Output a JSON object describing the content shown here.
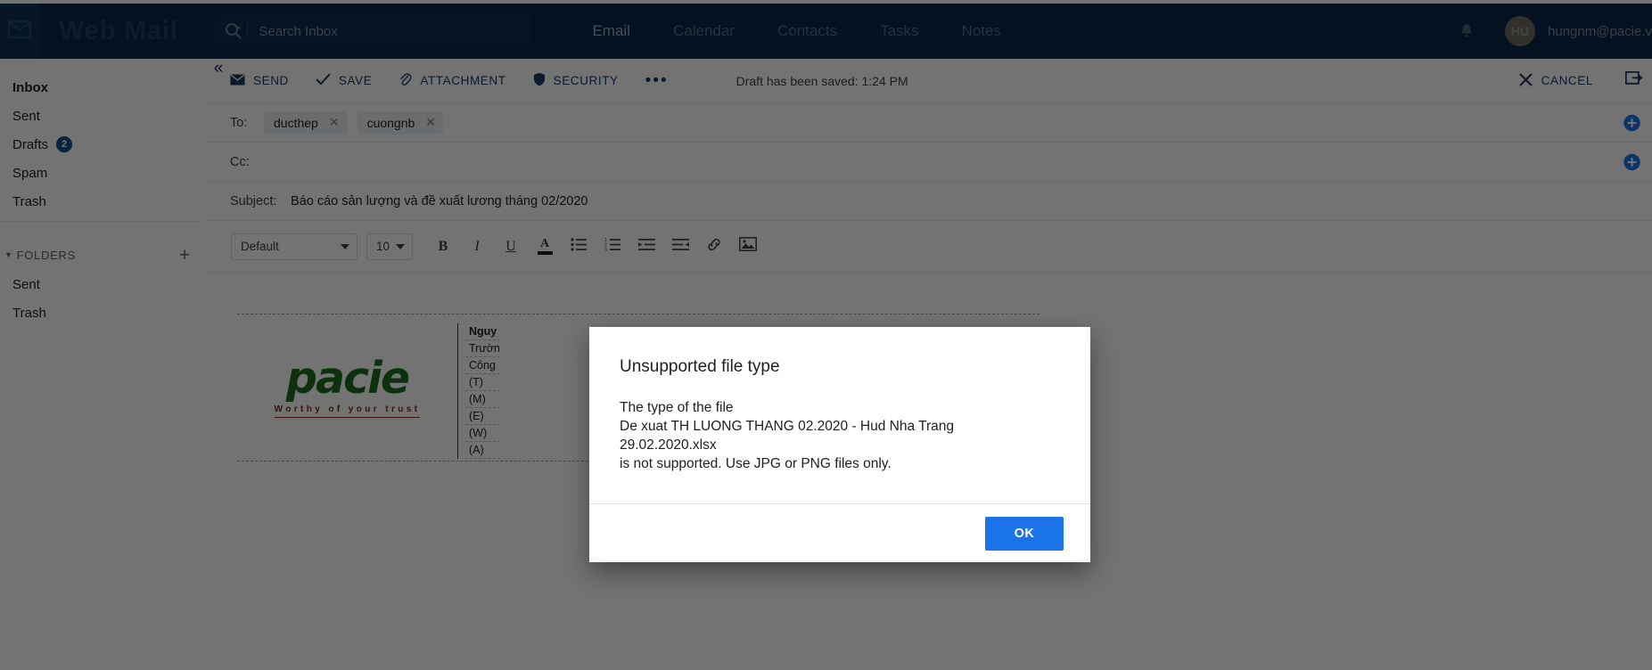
{
  "topnav": {
    "brand": "Web Mail",
    "mail_icon": "envelope-icon",
    "search": {
      "placeholder": "Search Inbox",
      "value": "",
      "icon": "search-icon"
    },
    "tabs": [
      {
        "label": "Email",
        "active": true
      },
      {
        "label": "Calendar",
        "active": false
      },
      {
        "label": "Contacts",
        "active": false
      },
      {
        "label": "Tasks",
        "active": false
      },
      {
        "label": "Notes",
        "active": false
      }
    ],
    "notification_icon": "bell-icon",
    "avatar_initials": "HU",
    "user_email": "hungnm@pacie.v"
  },
  "sidebar": {
    "items": [
      {
        "label": "Inbox",
        "selected": true,
        "badge": ""
      },
      {
        "label": "Sent",
        "selected": false,
        "badge": ""
      },
      {
        "label": "Drafts",
        "selected": false,
        "badge": "2"
      },
      {
        "label": "Spam",
        "selected": false,
        "badge": ""
      },
      {
        "label": "Trash",
        "selected": false,
        "badge": ""
      }
    ],
    "folders_header": "FOLDERS",
    "folders_add_icon": "plus-icon",
    "folders": [
      {
        "label": "Sent"
      },
      {
        "label": "Trash"
      }
    ]
  },
  "compose": {
    "collapse_icon": "double-chevron-left-icon",
    "toolbar": {
      "send_label": "SEND",
      "save_label": "SAVE",
      "attachment_label": "ATTACHMENT",
      "security_label": "SECURITY",
      "more_label": "•••",
      "draft_status": "Draft has been saved: 1:24 PM",
      "cancel_label": "CANCEL",
      "popout_icon": "popout-icon"
    },
    "to": {
      "label": "To:",
      "chips": [
        "ducthep",
        "cuongnb"
      ],
      "add_icon": "add-recipient-icon"
    },
    "cc": {
      "label": "Cc:",
      "value": "",
      "add_icon": "add-recipient-icon"
    },
    "subject": {
      "label": "Subject:",
      "value": "Báo cáo sản lượng và đề xuất lương tháng 02/2020"
    },
    "format_toolbar": {
      "font_family": "Default",
      "font_size": "10",
      "bold": "B",
      "italic": "I",
      "underline": "U",
      "text_color": "A",
      "buttons": [
        "bold-icon",
        "italic-icon",
        "underline-icon",
        "text-color-icon",
        "bulleted-list-icon",
        "numbered-list-icon",
        "indent-icon",
        "outdent-icon",
        "link-icon",
        "image-icon"
      ]
    },
    "signature": {
      "logo_word": "pacie",
      "logo_tagline": "Worthy of your trust",
      "rows": [
        {
          "text": "Nguy",
          "bold": true
        },
        {
          "text": "Trườn",
          "bold": false
        },
        {
          "text": "Công",
          "bold": false
        },
        {
          "text": "(T)",
          "bold": false
        },
        {
          "text": "(M)",
          "bold": false
        },
        {
          "text": "(E)",
          "bold": false
        },
        {
          "text": "(W)",
          "bold": false
        },
        {
          "text": "(A)",
          "bold": false
        }
      ]
    }
  },
  "dialog": {
    "title": "Unsupported file type",
    "line1": "The type of the file",
    "line2": "De xuat TH LUONG THANG 02.2020 - Hud Nha Trang",
    "line3": "29.02.2020.xlsx",
    "line4": "is not supported. Use JPG or PNG files only.",
    "ok_label": "OK"
  },
  "colors": {
    "navbar": "#0b2647",
    "accent_blue": "#1a73e8",
    "badge_blue": "#10508f",
    "logo_green": "#1d6b1d",
    "logo_red": "#7a2b1e"
  }
}
